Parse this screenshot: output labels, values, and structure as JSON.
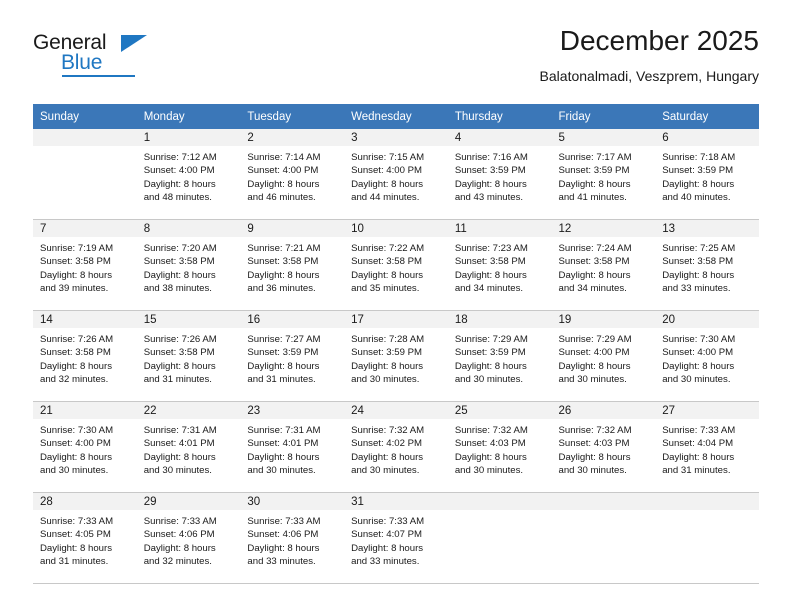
{
  "brand": {
    "name_part1": "General",
    "name_part2": "Blue"
  },
  "header": {
    "title": "December 2025",
    "location": "Balatonalmadi, Veszprem, Hungary"
  },
  "colors": {
    "header_blue": "#3b77b8",
    "logo_blue": "#1f77c2",
    "daynum_band": "#f2f2f2",
    "grid_line": "#c8c8c8"
  },
  "weekday_headers": [
    "Sunday",
    "Monday",
    "Tuesday",
    "Wednesday",
    "Thursday",
    "Friday",
    "Saturday"
  ],
  "weeks": [
    [
      {
        "day": "",
        "lines": []
      },
      {
        "day": "1",
        "lines": [
          "Sunrise: 7:12 AM",
          "Sunset: 4:00 PM",
          "Daylight: 8 hours",
          "and 48 minutes."
        ]
      },
      {
        "day": "2",
        "lines": [
          "Sunrise: 7:14 AM",
          "Sunset: 4:00 PM",
          "Daylight: 8 hours",
          "and 46 minutes."
        ]
      },
      {
        "day": "3",
        "lines": [
          "Sunrise: 7:15 AM",
          "Sunset: 4:00 PM",
          "Daylight: 8 hours",
          "and 44 minutes."
        ]
      },
      {
        "day": "4",
        "lines": [
          "Sunrise: 7:16 AM",
          "Sunset: 3:59 PM",
          "Daylight: 8 hours",
          "and 43 minutes."
        ]
      },
      {
        "day": "5",
        "lines": [
          "Sunrise: 7:17 AM",
          "Sunset: 3:59 PM",
          "Daylight: 8 hours",
          "and 41 minutes."
        ]
      },
      {
        "day": "6",
        "lines": [
          "Sunrise: 7:18 AM",
          "Sunset: 3:59 PM",
          "Daylight: 8 hours",
          "and 40 minutes."
        ]
      }
    ],
    [
      {
        "day": "7",
        "lines": [
          "Sunrise: 7:19 AM",
          "Sunset: 3:58 PM",
          "Daylight: 8 hours",
          "and 39 minutes."
        ]
      },
      {
        "day": "8",
        "lines": [
          "Sunrise: 7:20 AM",
          "Sunset: 3:58 PM",
          "Daylight: 8 hours",
          "and 38 minutes."
        ]
      },
      {
        "day": "9",
        "lines": [
          "Sunrise: 7:21 AM",
          "Sunset: 3:58 PM",
          "Daylight: 8 hours",
          "and 36 minutes."
        ]
      },
      {
        "day": "10",
        "lines": [
          "Sunrise: 7:22 AM",
          "Sunset: 3:58 PM",
          "Daylight: 8 hours",
          "and 35 minutes."
        ]
      },
      {
        "day": "11",
        "lines": [
          "Sunrise: 7:23 AM",
          "Sunset: 3:58 PM",
          "Daylight: 8 hours",
          "and 34 minutes."
        ]
      },
      {
        "day": "12",
        "lines": [
          "Sunrise: 7:24 AM",
          "Sunset: 3:58 PM",
          "Daylight: 8 hours",
          "and 34 minutes."
        ]
      },
      {
        "day": "13",
        "lines": [
          "Sunrise: 7:25 AM",
          "Sunset: 3:58 PM",
          "Daylight: 8 hours",
          "and 33 minutes."
        ]
      }
    ],
    [
      {
        "day": "14",
        "lines": [
          "Sunrise: 7:26 AM",
          "Sunset: 3:58 PM",
          "Daylight: 8 hours",
          "and 32 minutes."
        ]
      },
      {
        "day": "15",
        "lines": [
          "Sunrise: 7:26 AM",
          "Sunset: 3:58 PM",
          "Daylight: 8 hours",
          "and 31 minutes."
        ]
      },
      {
        "day": "16",
        "lines": [
          "Sunrise: 7:27 AM",
          "Sunset: 3:59 PM",
          "Daylight: 8 hours",
          "and 31 minutes."
        ]
      },
      {
        "day": "17",
        "lines": [
          "Sunrise: 7:28 AM",
          "Sunset: 3:59 PM",
          "Daylight: 8 hours",
          "and 30 minutes."
        ]
      },
      {
        "day": "18",
        "lines": [
          "Sunrise: 7:29 AM",
          "Sunset: 3:59 PM",
          "Daylight: 8 hours",
          "and 30 minutes."
        ]
      },
      {
        "day": "19",
        "lines": [
          "Sunrise: 7:29 AM",
          "Sunset: 4:00 PM",
          "Daylight: 8 hours",
          "and 30 minutes."
        ]
      },
      {
        "day": "20",
        "lines": [
          "Sunrise: 7:30 AM",
          "Sunset: 4:00 PM",
          "Daylight: 8 hours",
          "and 30 minutes."
        ]
      }
    ],
    [
      {
        "day": "21",
        "lines": [
          "Sunrise: 7:30 AM",
          "Sunset: 4:00 PM",
          "Daylight: 8 hours",
          "and 30 minutes."
        ]
      },
      {
        "day": "22",
        "lines": [
          "Sunrise: 7:31 AM",
          "Sunset: 4:01 PM",
          "Daylight: 8 hours",
          "and 30 minutes."
        ]
      },
      {
        "day": "23",
        "lines": [
          "Sunrise: 7:31 AM",
          "Sunset: 4:01 PM",
          "Daylight: 8 hours",
          "and 30 minutes."
        ]
      },
      {
        "day": "24",
        "lines": [
          "Sunrise: 7:32 AM",
          "Sunset: 4:02 PM",
          "Daylight: 8 hours",
          "and 30 minutes."
        ]
      },
      {
        "day": "25",
        "lines": [
          "Sunrise: 7:32 AM",
          "Sunset: 4:03 PM",
          "Daylight: 8 hours",
          "and 30 minutes."
        ]
      },
      {
        "day": "26",
        "lines": [
          "Sunrise: 7:32 AM",
          "Sunset: 4:03 PM",
          "Daylight: 8 hours",
          "and 30 minutes."
        ]
      },
      {
        "day": "27",
        "lines": [
          "Sunrise: 7:33 AM",
          "Sunset: 4:04 PM",
          "Daylight: 8 hours",
          "and 31 minutes."
        ]
      }
    ],
    [
      {
        "day": "28",
        "lines": [
          "Sunrise: 7:33 AM",
          "Sunset: 4:05 PM",
          "Daylight: 8 hours",
          "and 31 minutes."
        ]
      },
      {
        "day": "29",
        "lines": [
          "Sunrise: 7:33 AM",
          "Sunset: 4:06 PM",
          "Daylight: 8 hours",
          "and 32 minutes."
        ]
      },
      {
        "day": "30",
        "lines": [
          "Sunrise: 7:33 AM",
          "Sunset: 4:06 PM",
          "Daylight: 8 hours",
          "and 33 minutes."
        ]
      },
      {
        "day": "31",
        "lines": [
          "Sunrise: 7:33 AM",
          "Sunset: 4:07 PM",
          "Daylight: 8 hours",
          "and 33 minutes."
        ]
      },
      {
        "day": "",
        "lines": []
      },
      {
        "day": "",
        "lines": []
      },
      {
        "day": "",
        "lines": []
      }
    ]
  ]
}
